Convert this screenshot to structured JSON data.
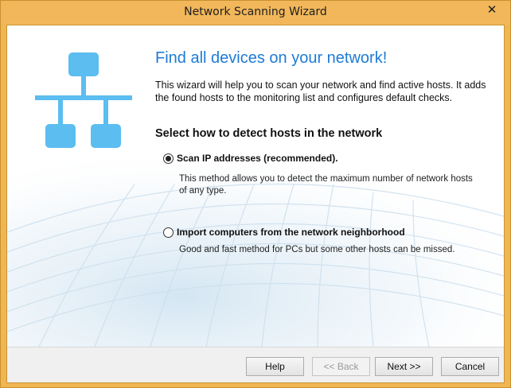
{
  "window": {
    "title": "Network Scanning Wizard",
    "close_glyph": "✕"
  },
  "main": {
    "heading": "Find all devices on your network!",
    "intro": "This wizard will help you to scan your network and find active hosts. It adds the found hosts to the monitoring list and configures default checks.",
    "section_title": "Select how to detect hosts in the network",
    "options": [
      {
        "label": "Scan IP addresses (recommended).",
        "description": "This method allows you to detect the maximum number of network hosts of any type.",
        "selected": true
      },
      {
        "label": "Import computers from the network neighborhood",
        "description": "Good and fast method for PCs but some other hosts can be missed.",
        "selected": false
      }
    ]
  },
  "buttons": {
    "help": "Help",
    "back": "<< Back",
    "next": "Next >>",
    "cancel": "Cancel"
  },
  "icons": {
    "network": "network-topology-icon"
  },
  "colors": {
    "frame": "#efb653",
    "heading": "#1d7bd6",
    "network_icon": "#5bbdf0"
  }
}
